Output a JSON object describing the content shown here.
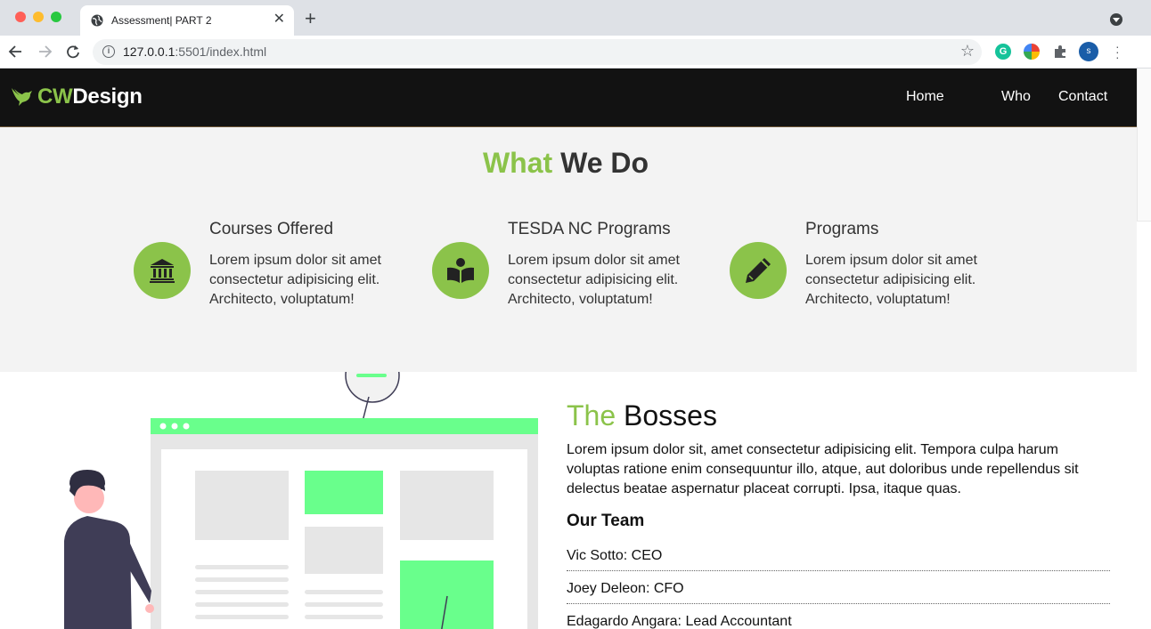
{
  "browser": {
    "tab_title": "Assessment| PART 2",
    "url_host": "127.0.0.1",
    "url_rest": ":5501/index.html",
    "avatar_letter": "s",
    "grammarly_letter": "G"
  },
  "site": {
    "logo_cw": "CW",
    "logo_design": "Design",
    "nav": [
      "Home",
      "Who",
      "Contact"
    ]
  },
  "what": {
    "title_accent": "What",
    "title_rest": " We Do",
    "features": [
      {
        "icon": "bank-icon",
        "title": "Courses Offered",
        "text": "Lorem ipsum dolor sit amet consectetur adipisicing elit. Architecto, voluptatum!"
      },
      {
        "icon": "book-reader-icon",
        "title": "TESDA NC Programs",
        "text": "Lorem ipsum dolor sit amet consectetur adipisicing elit. Architecto, voluptatum!"
      },
      {
        "icon": "pencil-icon",
        "title": "Programs",
        "text": "Lorem ipsum dolor sit amet consectetur adipisicing elit. Architecto, voluptatum!"
      }
    ]
  },
  "about": {
    "title_accent": "The",
    "title_rest": " Bosses",
    "body": "Lorem ipsum dolor sit, amet consectetur adipisicing elit. Tempora culpa harum voluptas ratione enim consequuntur illo, atque, aut doloribus unde repellendus sit delectus beatae aspernatur placeat corrupti. Ipsa, itaque quas.",
    "team_heading": "Our Team",
    "team": [
      "Vic Sotto: CEO",
      "Joey Deleon: CFO",
      "Edagardo Angara: Lead Accountant"
    ]
  },
  "colors": {
    "accent": "#8bc34a",
    "nav_bg": "#121212",
    "section_bg": "#f3f3f3",
    "illustration_green": "#69ff8c"
  }
}
